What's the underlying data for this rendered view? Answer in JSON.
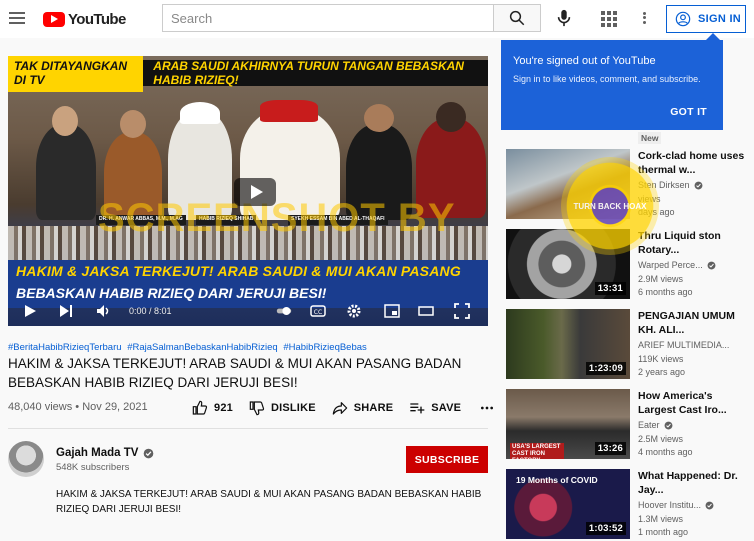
{
  "header": {
    "logo_text": "YouTube",
    "search_placeholder": "Search",
    "signin_label": "SIGN IN"
  },
  "player": {
    "banner_left": "TAK DITAYANGKAN DI TV",
    "banner_right": "ARAB SAUDI AKHIRNYA TURUN TANGAN BEBASKAN HABIB RIZIEQ!",
    "name_tags": [
      "DR. H. ANWAR ABBAS, M.M., M.AG",
      "HABIB RIZIEQ SHIHAB",
      "SYEKH ESSAM BIN ABED AL-THAQAFI"
    ],
    "headline_1": "HAKIM & JAKSA TERKEJUT! ARAB SAUDI & MUI AKAN PASANG BADAN",
    "headline_2": "BEBASKAN HABIB RIZIEQ DARI JERUJI BESI!",
    "time": "0:00 / 8:01",
    "watermark": "SCREENSHOT BY",
    "progress": 0
  },
  "video": {
    "hashtags": [
      "#BeritaHabibRizieqTerbaru",
      "#RajaSalmanBebaskanHabibRizieq",
      "#HabibRizieqBebas"
    ],
    "title": "HAKIM & JAKSA TERKEJUT! ARAB SAUDI & MUI AKAN PASANG BADAN BEBASKAN HABIB RIZIEQ DARI JERUJI BESI!",
    "views": "48,040 views",
    "date": "Nov 29, 2021",
    "likes": "921",
    "dislike_label": "DISLIKE",
    "share_label": "SHARE",
    "save_label": "SAVE"
  },
  "channel": {
    "name": "Gajah Mada TV",
    "subscribers": "548K subscribers",
    "subscribe_label": "SUBSCRIBE",
    "description": "HAKIM & JAKSA TERKEJUT! ARAB SAUDI & MUI AKAN PASANG BADAN BEBASKAN HABIB RIZIEQ DARI JERUJI BESI!"
  },
  "popup": {
    "title": "You're signed out of YouTube",
    "body": "Sign in to like videos, comment, and subscribe.",
    "button": "GOT IT"
  },
  "sidebar": {
    "new_badge": "New",
    "hoax_badge_text": "TURN BACK HOAX",
    "items": [
      {
        "title": "Cork-clad home uses thermal w...",
        "channel": "Sten Dirksen",
        "views": "views",
        "ago": "days ago",
        "duration": ""
      },
      {
        "title": "Thru Liquid ston Rotary...",
        "channel": "Warped Perce...",
        "views": "2.9M views",
        "ago": "6 months ago",
        "duration": "13:31"
      },
      {
        "title": "PENGAJIAN UMUM KH. ALI...",
        "channel": "ARIEF MULTIMEDIA...",
        "views": "119K views",
        "ago": "2 years ago",
        "duration": "1:23:09"
      },
      {
        "title": "How America's Largest Cast Iro...",
        "channel": "Eater",
        "views": "2.5M views",
        "ago": "4 months ago",
        "duration": "13:26"
      },
      {
        "title": "What Happened: Dr. Jay...",
        "channel": "Hoover Institu...",
        "views": "1.3M views",
        "ago": "1 month ago",
        "duration": "1:03:52"
      }
    ]
  },
  "thumb_text": {
    "cast_iron_caption": "USA'S LARGEST CAST IRON FACTORY",
    "covid_caption": "19 Months of COVID"
  }
}
